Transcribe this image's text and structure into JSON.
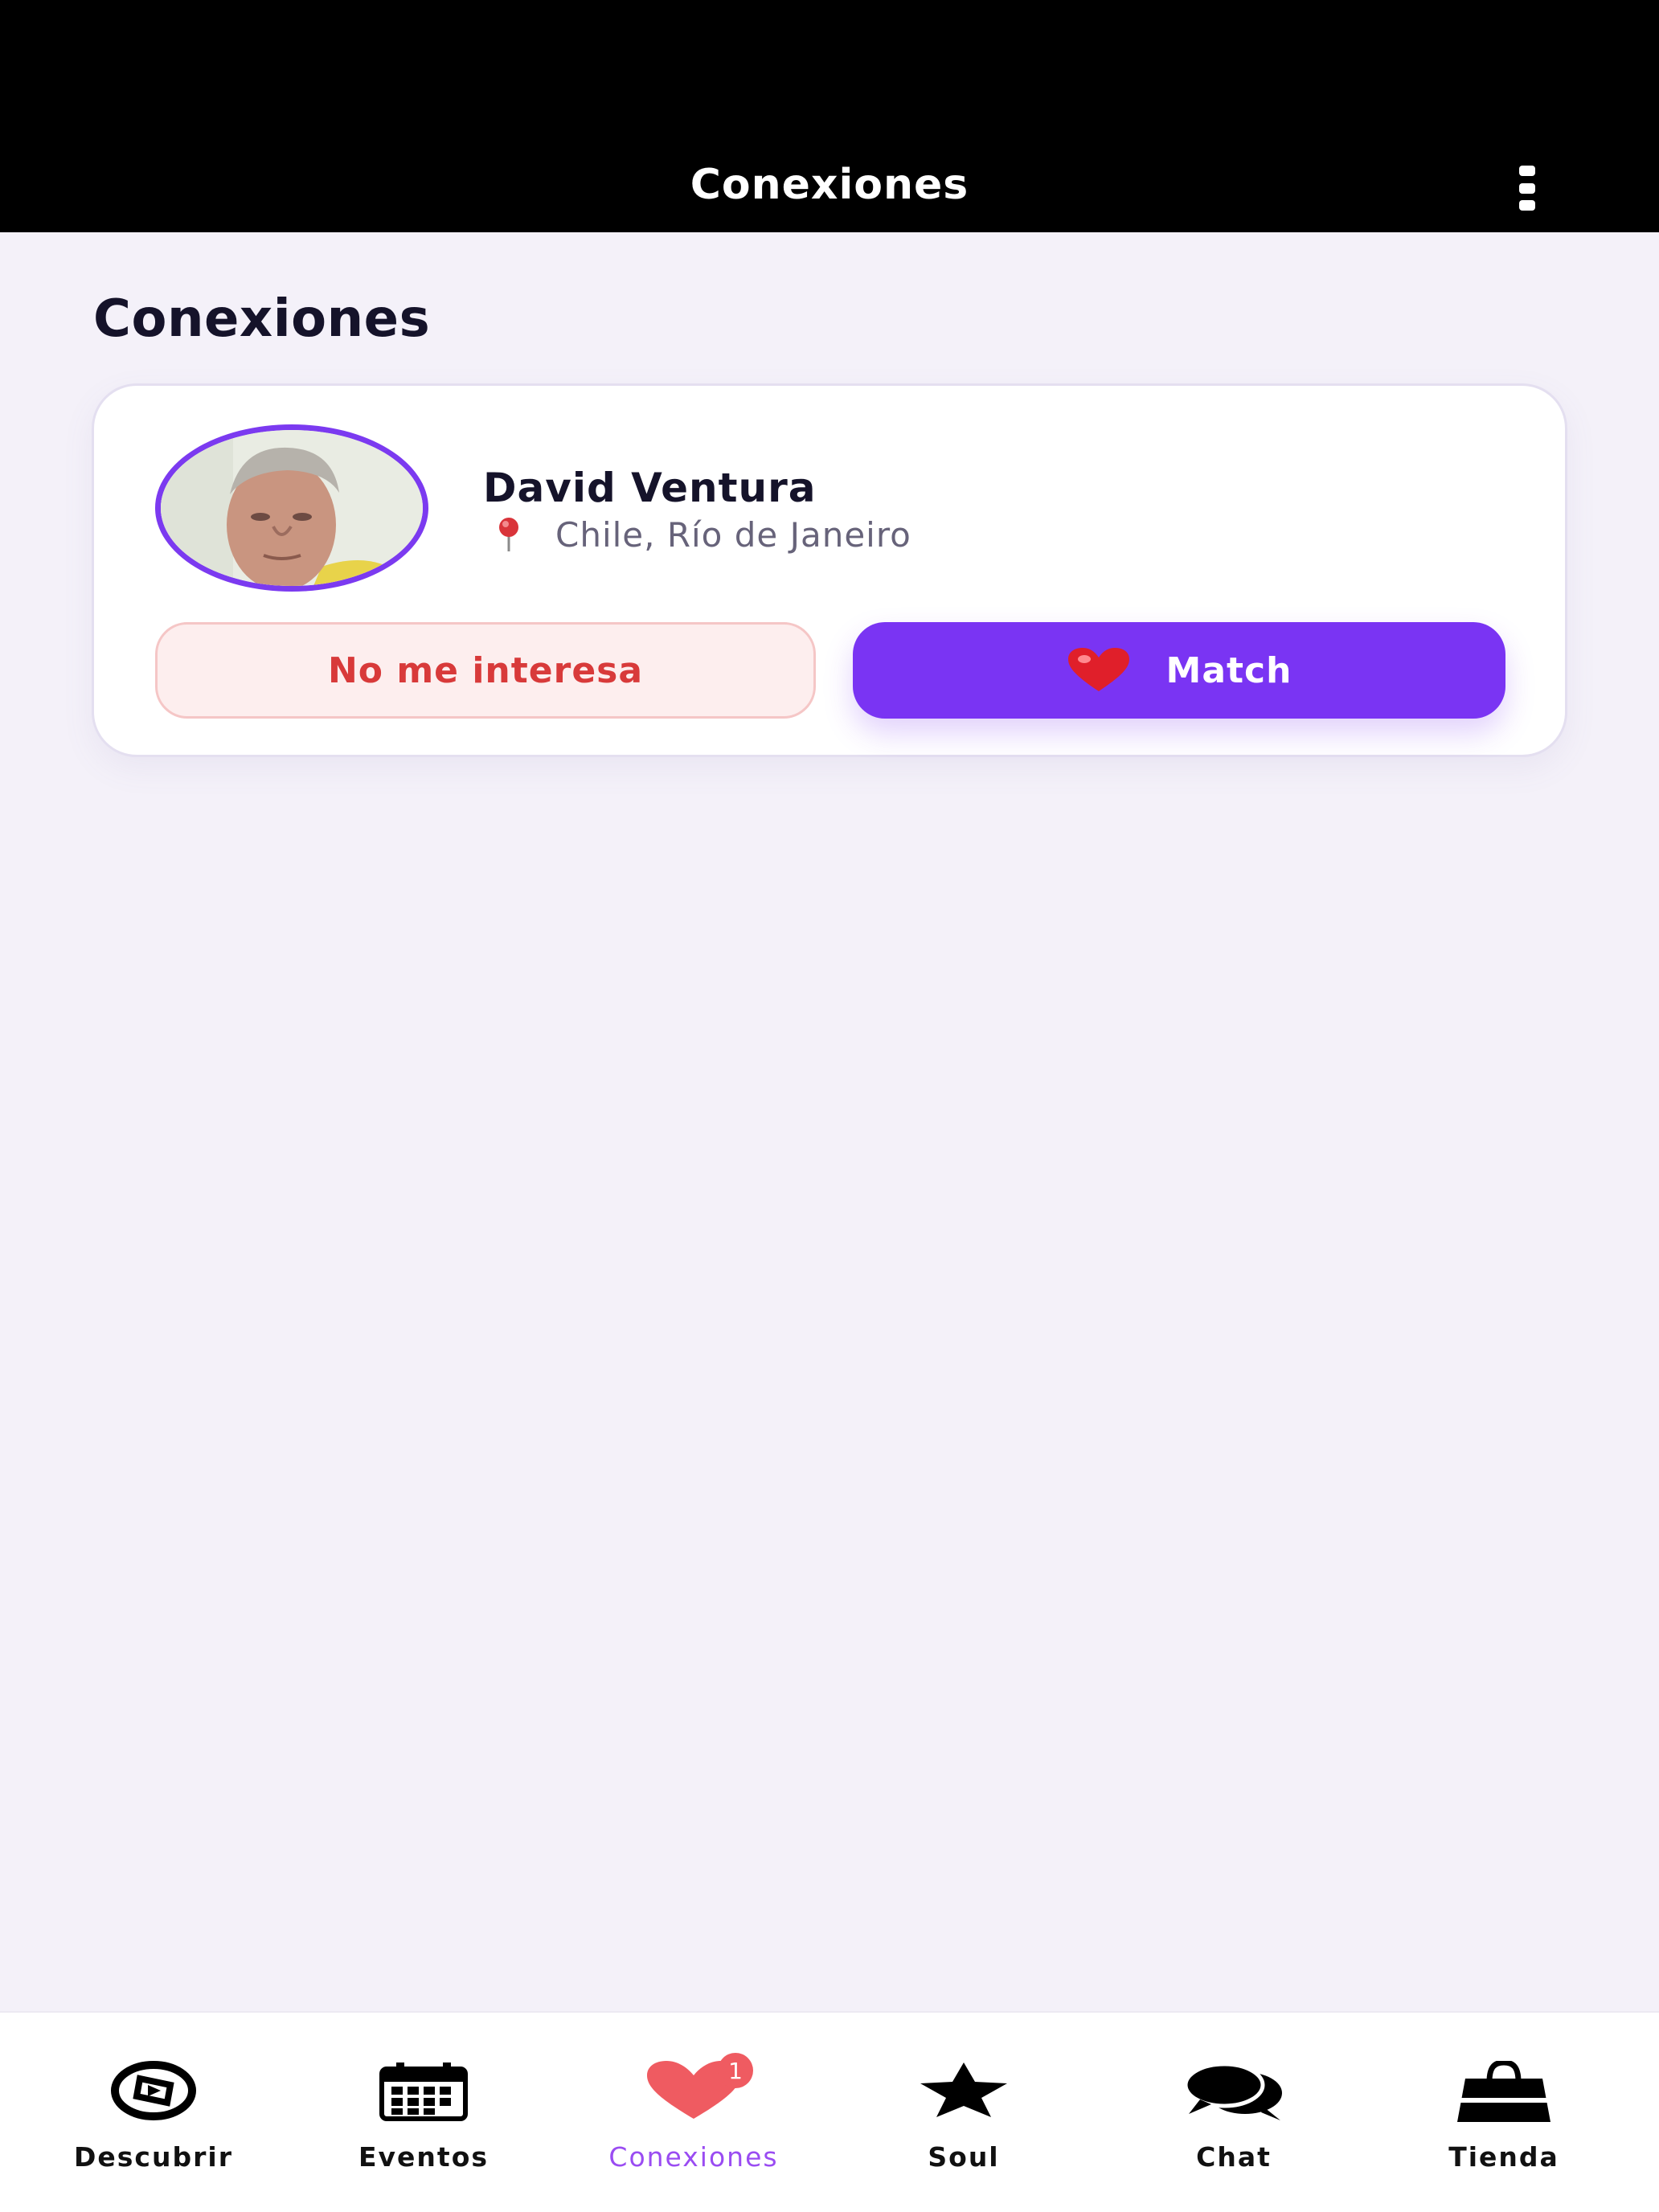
{
  "header": {
    "title": "Conexiones",
    "menu_icon": "kebab-menu-icon"
  },
  "page": {
    "title": "Conexiones"
  },
  "connection": {
    "name": "David Ventura",
    "location": "Chile, Río de Janeiro",
    "location_icon": "pushpin-icon",
    "decline_label": "No me interesa",
    "match_label": "Match",
    "match_icon": "heart-icon"
  },
  "colors": {
    "accent": "#7a34f3",
    "decline_text": "#d83a3a",
    "decline_bg": "#fdeeee",
    "badge": "#ef5b61",
    "active_tab": "#9a4cf2"
  },
  "nav": {
    "items": [
      {
        "label": "Descubrir",
        "icon": "compass-icon"
      },
      {
        "label": "Eventos",
        "icon": "calendar-icon"
      },
      {
        "label": "Conexiones",
        "icon": "heart-icon",
        "active": true,
        "badge": "1"
      },
      {
        "label": "Soul",
        "icon": "star-icon"
      },
      {
        "label": "Chat",
        "icon": "chat-bubbles-icon"
      },
      {
        "label": "Tienda",
        "icon": "shopping-bag-icon"
      }
    ]
  }
}
